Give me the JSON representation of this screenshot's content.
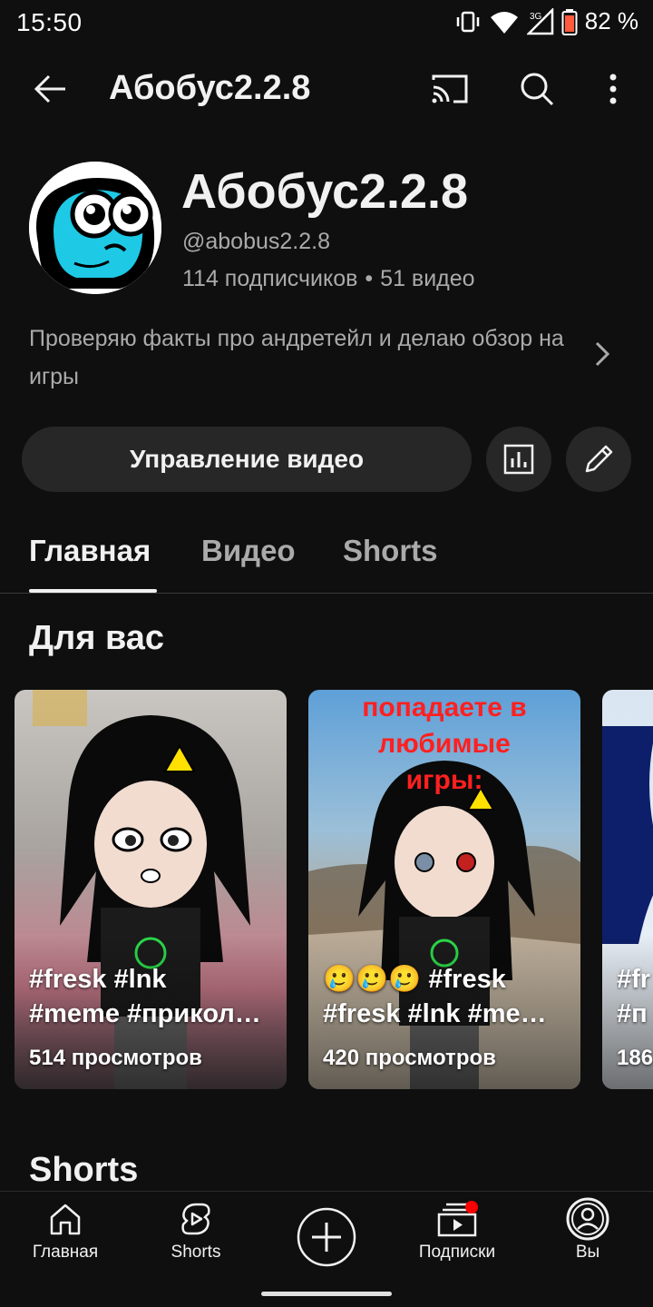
{
  "status_bar": {
    "time": "15:50",
    "battery_percent": "82 %",
    "network_label": "3G"
  },
  "app_bar": {
    "title": "Абобус2.2.8",
    "icons": [
      "back-arrow-icon",
      "cast-icon",
      "search-icon",
      "more-vert-icon"
    ]
  },
  "channel": {
    "name": "Абобус2.2.8",
    "handle": "@abobus2.2.8",
    "subscribers": "114 подписчиков",
    "separator": "•",
    "videos": "51 видео",
    "description": "Проверяю факты про андретейл и делаю обзор на игры"
  },
  "actions": {
    "manage_label": "Управление видео",
    "analytics_icon": "analytics-icon",
    "edit_icon": "edit-pencil-icon"
  },
  "tabs": [
    {
      "label": "Главная",
      "active": true
    },
    {
      "label": "Видео",
      "active": false
    },
    {
      "label": "Shorts",
      "active": false
    }
  ],
  "sections": {
    "for_you": "Для вас",
    "shorts": "Shorts"
  },
  "cards": [
    {
      "title_line1": "#fresk #lnk",
      "title_line2": "#meme #прикол…",
      "views": "514 просмотров"
    },
    {
      "overlay_line1": "попадаете в",
      "overlay_line2": "любимые",
      "overlay_line3": "игры:",
      "title_line1": "🥲🥲🥲 #fresk",
      "title_line2": "#fresk #lnk #me…",
      "views": "420 просмотров"
    },
    {
      "title_line1": "#fr",
      "title_line2": "#п",
      "views": "186"
    }
  ],
  "bottom_nav": [
    {
      "label": "Главная",
      "icon": "home-icon"
    },
    {
      "label": "Shorts",
      "icon": "shorts-icon"
    },
    {
      "label": "",
      "icon": "create-plus-icon"
    },
    {
      "label": "Подписки",
      "icon": "subscriptions-icon"
    },
    {
      "label": "Вы",
      "icon": "account-icon"
    }
  ],
  "colors": {
    "background": "#0f0f0f",
    "surface": "#272727",
    "text_primary": "#f1f1f1",
    "text_secondary": "#aaaaaa",
    "notify": "#ff0000",
    "overlay_red": "#ff2020"
  }
}
